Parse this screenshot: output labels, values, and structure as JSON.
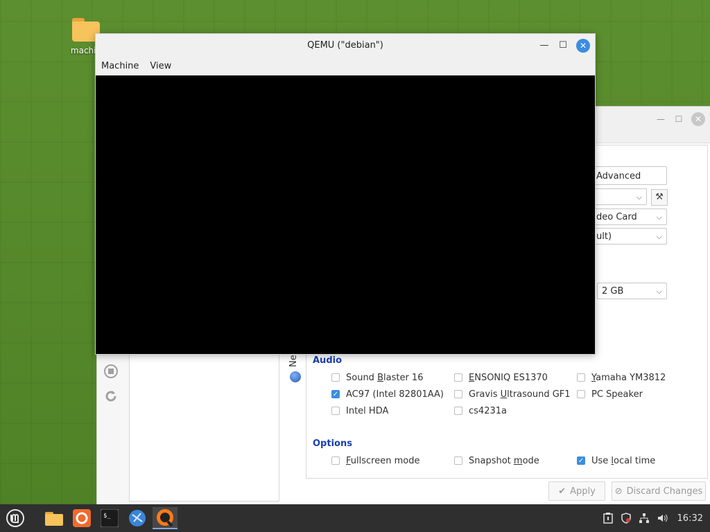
{
  "desktop": {
    "icon_label": "machin"
  },
  "qemu": {
    "title": "QEMU (\"debian\")",
    "menu": [
      "Machine",
      "View"
    ]
  },
  "settings": {
    "tab_advanced": "Advanced",
    "video_card": "deo Card",
    "combo_default": "ult)",
    "ram": "2 GB",
    "vertical_tab": "Net",
    "audio": {
      "title": "Audio",
      "col1": [
        {
          "label": "Sound Blaster 16",
          "checked": false
        },
        {
          "label": "AC97 (Intel 82801AA)",
          "checked": true
        },
        {
          "label": "Intel HDA",
          "checked": false
        }
      ],
      "col2": [
        {
          "label": "ENSONIQ ES1370",
          "checked": false
        },
        {
          "label": "Gravis Ultrasound GF1",
          "checked": false
        },
        {
          "label": "cs4231a",
          "checked": false
        }
      ],
      "col3": [
        {
          "label": "Yamaha YM3812",
          "checked": false
        },
        {
          "label": "PC Speaker",
          "checked": false
        }
      ]
    },
    "options": {
      "title": "Options",
      "items": [
        {
          "label": "Fullscreen mode",
          "checked": false
        },
        {
          "label": "Snapshot mode",
          "checked": false
        },
        {
          "label": "Use local time",
          "checked": true
        }
      ]
    },
    "apply_label": "Apply",
    "discard_label": "Discard Changes"
  },
  "taskbar": {
    "time": "16:32"
  },
  "colors": {
    "accent": "#3b8de0",
    "section_title": "#1a3fb2"
  }
}
